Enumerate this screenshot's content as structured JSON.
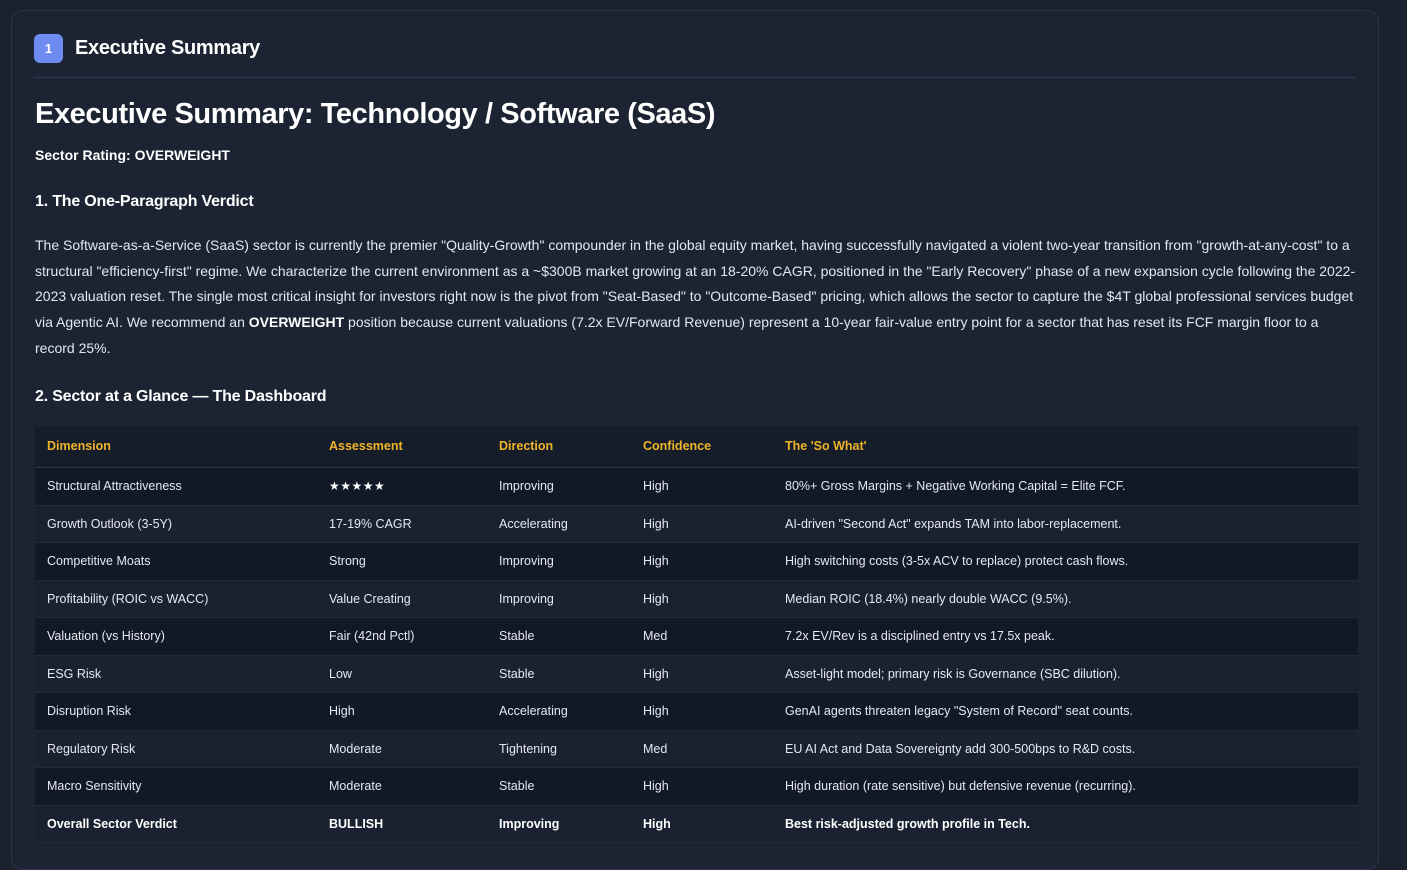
{
  "card": {
    "badge": "1",
    "title": "Executive Summary"
  },
  "report": {
    "title": "Executive Summary: Technology / Software (SaaS)",
    "rating_label": "Sector Rating: OVERWEIGHT",
    "section1_title": "1. The One-Paragraph Verdict",
    "paragraph_pre": "The Software-as-a-Service (SaaS) sector is currently the premier \"Quality-Growth\" compounder in the global equity market, having successfully navigated a violent two-year transition from \"growth-at-any-cost\" to a structural \"efficiency-first\" regime. We characterize the current environment as a ~$300B market growing at an 18-20% CAGR, positioned in the \"Early Recovery\" phase of a new expansion cycle following the 2022-2023 valuation reset. The single most critical insight for investors right now is the pivot from \"Seat-Based\" to \"Outcome-Based\" pricing, which allows the sector to capture the $4T global professional services budget via Agentic AI. We recommend an ",
    "paragraph_bold": "OVERWEIGHT",
    "paragraph_post": " position because current valuations (7.2x EV/Forward Revenue) represent a 10-year fair-value entry point for a sector that has reset its FCF margin floor to a record 25%.",
    "section2_title": "2. Sector at a Glance — The Dashboard"
  },
  "table": {
    "headers": [
      "Dimension",
      "Assessment",
      "Direction",
      "Confidence",
      "The 'So What'"
    ],
    "rows": [
      [
        "Structural Attractiveness",
        "★★★★★",
        "Improving",
        "High",
        "80%+ Gross Margins + Negative Working Capital = Elite FCF."
      ],
      [
        "Growth Outlook (3-5Y)",
        "17-19% CAGR",
        "Accelerating",
        "High",
        "AI-driven \"Second Act\" expands TAM into labor-replacement."
      ],
      [
        "Competitive Moats",
        "Strong",
        "Improving",
        "High",
        "High switching costs (3-5x ACV to replace) protect cash flows."
      ],
      [
        "Profitability (ROIC vs WACC)",
        "Value Creating",
        "Improving",
        "High",
        "Median ROIC (18.4%) nearly double WACC (9.5%)."
      ],
      [
        "Valuation (vs History)",
        "Fair (42nd Pctl)",
        "Stable",
        "Med",
        "7.2x EV/Rev is a disciplined entry vs 17.5x peak."
      ],
      [
        "ESG Risk",
        "Low",
        "Stable",
        "High",
        "Asset-light model; primary risk is Governance (SBC dilution)."
      ],
      [
        "Disruption Risk",
        "High",
        "Accelerating",
        "High",
        "GenAI agents threaten legacy \"System of Record\" seat counts."
      ],
      [
        "Regulatory Risk",
        "Moderate",
        "Tightening",
        "Med",
        "EU AI Act and Data Sovereignty add 300-500bps to R&D costs."
      ],
      [
        "Macro Sensitivity",
        "Moderate",
        "Stable",
        "High",
        "High duration (rate sensitive) but defensive revenue (recurring)."
      ],
      [
        "Overall Sector Verdict",
        "BULLISH",
        "Improving",
        "High",
        "Best risk-adjusted growth profile in Tech."
      ]
    ]
  }
}
